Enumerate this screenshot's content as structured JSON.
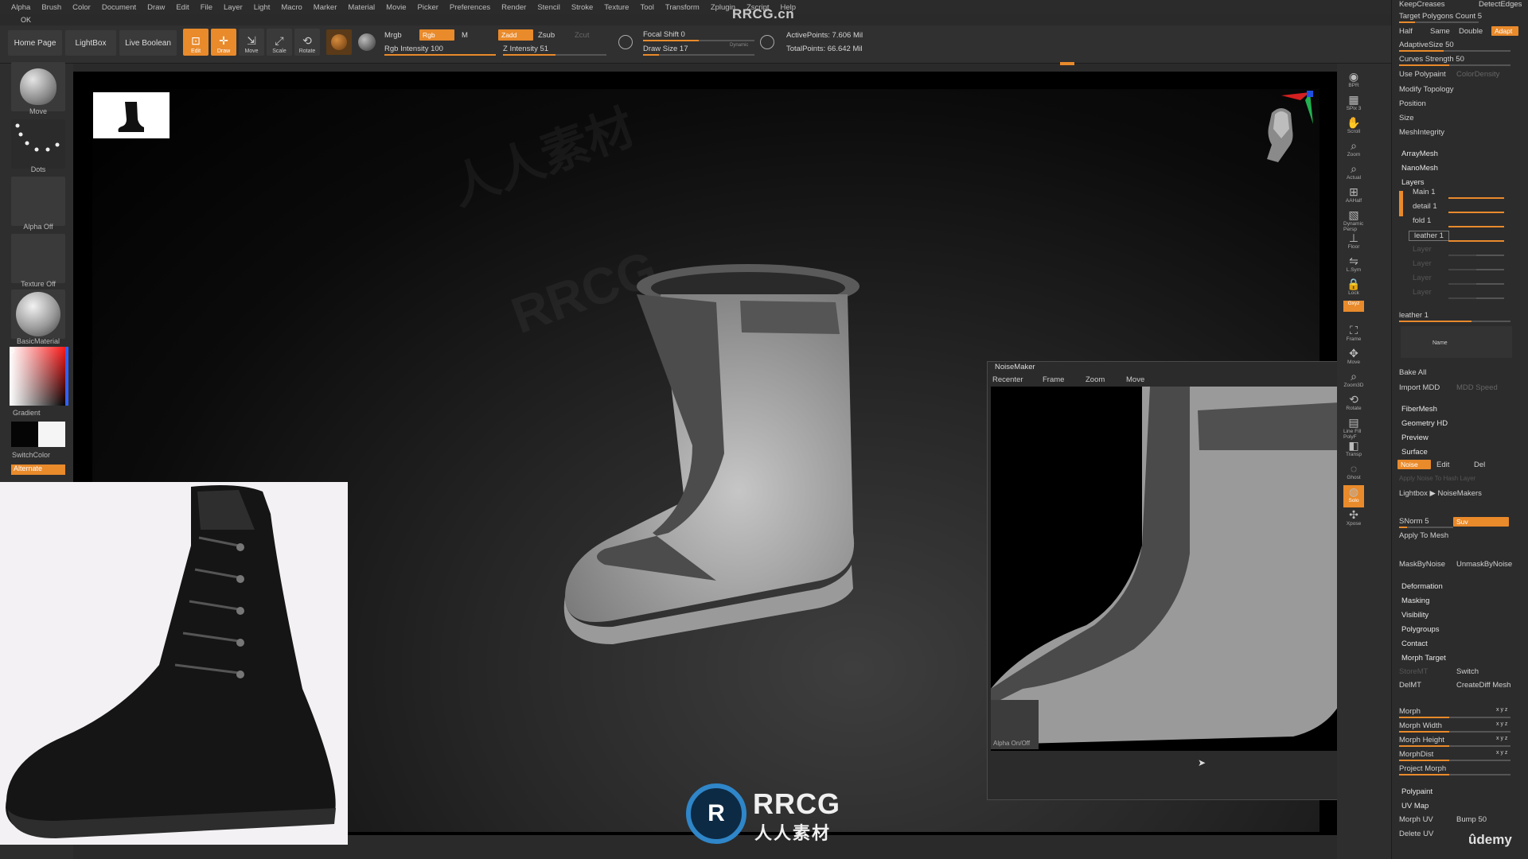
{
  "menu": [
    "Alpha",
    "Brush",
    "Color",
    "Document",
    "Draw",
    "Edit",
    "File",
    "Layer",
    "Light",
    "Macro",
    "Marker",
    "Material",
    "Movie",
    "Picker",
    "Preferences",
    "Render",
    "Stencil",
    "Stroke",
    "Texture",
    "Tool",
    "Transform",
    "Zplugin",
    "Zscript",
    "Help"
  ],
  "ok_label": "OK",
  "watermark_header": "RRCG.cn",
  "toolbar": {
    "home_page": "Home Page",
    "lightbox": "LightBox",
    "live_boolean": "Live Boolean",
    "edit": "Edit",
    "draw": "Draw",
    "move": "Move",
    "scale": "Scale",
    "rotate": "Rotate",
    "mrgb": "Mrgb",
    "rgb": "Rgb",
    "m": "M",
    "rgb_intensity": "Rgb Intensity 100",
    "zadd": "Zadd",
    "zsub": "Zsub",
    "zcut": "Zcut",
    "z_intensity": "Z Intensity 51",
    "focal_shift": "Focal Shift 0",
    "draw_size": "Draw Size 17",
    "dynamic": "Dynamic",
    "active_points": "ActivePoints: 7.606 Mil",
    "total_points": "TotalPoints: 66.642 Mil"
  },
  "left_tray": {
    "move": "Move",
    "dots": "Dots",
    "alpha_off": "Alpha Off",
    "texture_off": "Texture Off",
    "basic_material": "BasicMaterial",
    "gradient": "Gradient",
    "switch_color": "SwitchColor",
    "alternate": "Alternate"
  },
  "right_tray": [
    "BPR",
    "SPix 3",
    "Scroll",
    "Zoom",
    "Actual",
    "AAHalf",
    "Dynamic Persp",
    "Floor",
    "L.Sym",
    "Lock",
    "Gxyz",
    "Frame",
    "Move",
    "Zoom3D",
    "Rotate",
    "Line Fill PolyF",
    "Transp",
    "Ghost",
    "Solo",
    "Xpose"
  ],
  "noisemaker": {
    "title": "NoiseMaker",
    "buttons": [
      "Recenter",
      "Frame",
      "Zoom",
      "Move"
    ],
    "alpha_toggle": "Alpha On/Off"
  },
  "right_panel": {
    "keep_creases": "KeepCreases",
    "detect_edges": "DetectEdges",
    "target_polygons": "Target Polygons Count 5",
    "half": "Half",
    "same": "Same",
    "double": "Double",
    "adapt": "Adapt",
    "adaptive_size": "AdaptiveSize 50",
    "curves_strength": "Curves Strength 50",
    "use_polypaint": "Use Polypaint",
    "color_density": "ColorDensity",
    "modify_topology": "Modify Topology",
    "position": "Position",
    "size": "Size",
    "mesh_integrity": "MeshIntegrity",
    "array_mesh": "ArrayMesh",
    "nano_mesh": "NanoMesh",
    "layers": "Layers",
    "layer_items": [
      "Main 1",
      "detail 1",
      "fold 1",
      "leather 1",
      "Layer",
      "Layer",
      "Layer",
      "Layer"
    ],
    "leather_slider": "leather 1",
    "name": "Name",
    "bake_all": "Bake All",
    "import_mdd": "Import MDD",
    "mdd_speed": "MDD Speed",
    "fiber_mesh": "FiberMesh",
    "geometry_hd": "Geometry HD",
    "preview": "Preview",
    "surface": "Surface",
    "noise": "Noise",
    "edit": "Edit",
    "del": "Del",
    "apply_noise": "Apply Noise To Hash Layer",
    "lightbox_noise": "Lightbox ▶ NoiseMakers",
    "snorm": "SNorm 5",
    "suv": "Suv",
    "apply_to_mesh": "Apply To Mesh",
    "mask_by_noise": "MaskByNoise",
    "unmask_by_noise": "UnmaskByNoise",
    "deformation": "Deformation",
    "masking": "Masking",
    "visibility": "Visibility",
    "polygroups": "Polygroups",
    "contact": "Contact",
    "morph_target": "Morph Target",
    "store_mt": "StoreMT",
    "switch": "Switch",
    "del_mt": "DelMT",
    "create_diff_mesh": "CreateDiff Mesh",
    "morph": "Morph",
    "morph_width": "Morph Width",
    "morph_height": "Morph Height",
    "morph_dist": "MorphDist",
    "project_morph": "Project Morph",
    "xyz": "x y z",
    "polypaint": "Polypaint",
    "uv_map": "UV Map",
    "morph_uv": "Morph UV",
    "bump": "Bump 50",
    "delete_uv": "Delete UV",
    "udemy": "ûdemy"
  },
  "watermark": {
    "rrcg": "RRCG",
    "cn": "人人素材"
  },
  "colors": {
    "accent": "#e98a2b",
    "panel": "#2c2c2c",
    "canvas": "#000000"
  }
}
